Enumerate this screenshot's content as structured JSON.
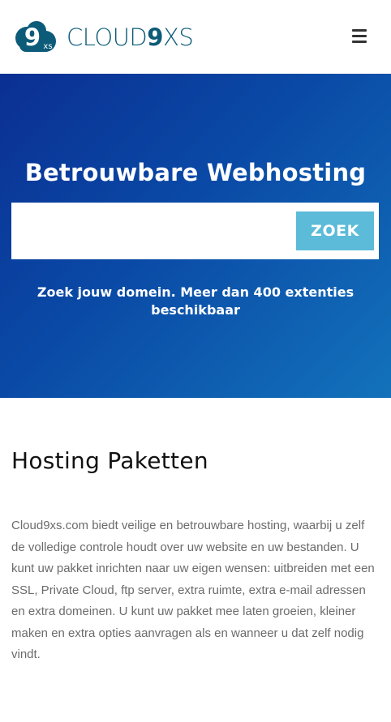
{
  "header": {
    "logo": {
      "mark_number": "9",
      "mark_suffix": "xs",
      "word_prefix": "CLOUD",
      "word_bold": "9",
      "word_suffix": "XS"
    },
    "menu_icon": "hamburger-menu-icon"
  },
  "hero": {
    "title": "Betrouwbare Webhosting",
    "search": {
      "placeholder": "",
      "value": "",
      "button_label": "ZOEK"
    },
    "subtitle": "Zoek jouw domein. Meer dan 400 extenties beschikbaar"
  },
  "content": {
    "title": "Hosting Paketten",
    "text": "Cloud9xs.com biedt veilige en betrouwbare hosting, waarbij u zelf de volledige controle houdt over uw website en uw bestanden. U kunt uw pakket inrichten naar uw eigen wensen: uitbreiden met een SSL, Private Cloud, ftp server, extra ruimte, extra e-mail adressen en extra domeinen. U kunt uw pakket mee laten groeien, kleiner maken en extra opties aanvragen als en wanneer u dat zelf nodig vindt."
  },
  "colors": {
    "brand": "#0c5b78",
    "hero_start": "#0b2f93",
    "hero_end": "#1372bb",
    "button": "#5bbbd9",
    "body_text": "#6b6b6b"
  }
}
